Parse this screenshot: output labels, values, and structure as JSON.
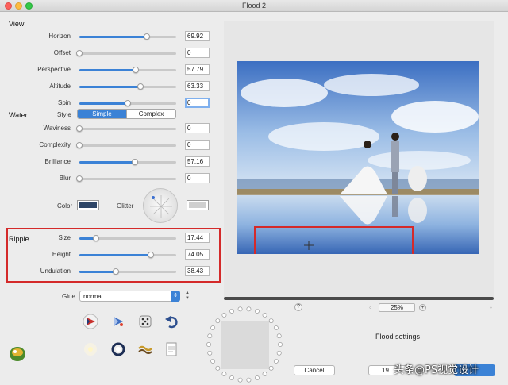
{
  "window": {
    "title": "Flood 2"
  },
  "sections": {
    "view": "View",
    "water": "Water",
    "ripple": "Ripple"
  },
  "view_rows": [
    {
      "label": "Horizon",
      "value": "69.92",
      "level": 0.7
    },
    {
      "label": "Offset",
      "value": "0",
      "level": 0.0
    },
    {
      "label": "Perspective",
      "value": "57.79",
      "level": 0.58
    },
    {
      "label": "Altitude",
      "value": "63.33",
      "level": 0.63
    },
    {
      "label": "Spin",
      "value": "0",
      "level": 0.5
    }
  ],
  "water": {
    "style_label": "Style",
    "style_options": [
      "Simple",
      "Complex"
    ],
    "style_selected": "Simple",
    "rows": [
      {
        "label": "Waviness",
        "value": "0",
        "level": 0.0
      },
      {
        "label": "Complexity",
        "value": "0",
        "level": 0.0
      },
      {
        "label": "Brilliance",
        "value": "57.16",
        "level": 0.57
      },
      {
        "label": "Blur",
        "value": "0",
        "level": 0.0
      }
    ],
    "color_label": "Color",
    "color_value": "#2e4566",
    "glitter_label": "Glitter",
    "glitter_color": "#cfcfcf"
  },
  "ripple_rows": [
    {
      "label": "Size",
      "value": "17.44",
      "level": 0.17
    },
    {
      "label": "Height",
      "value": "74.05",
      "level": 0.74
    },
    {
      "label": "Undulation",
      "value": "38.43",
      "level": 0.38
    }
  ],
  "glue": {
    "label": "Glue",
    "value": "normal"
  },
  "tools": [
    "red-arrow-icon",
    "blue-arrow-icon",
    "dice-icon",
    "undo-arrow-icon",
    "sparkle-icon",
    "ring-icon",
    "wave-icon",
    "document-icon"
  ],
  "preview": {
    "zoom": "25%",
    "help": "?"
  },
  "footer": {
    "flood_settings": "Flood settings",
    "cancel": "Cancel",
    "ok_partial": "19"
  },
  "watermark": "头条@PS视觉设计",
  "colors": {
    "accent": "#3b82d6",
    "highlight": "#d42a2a"
  }
}
